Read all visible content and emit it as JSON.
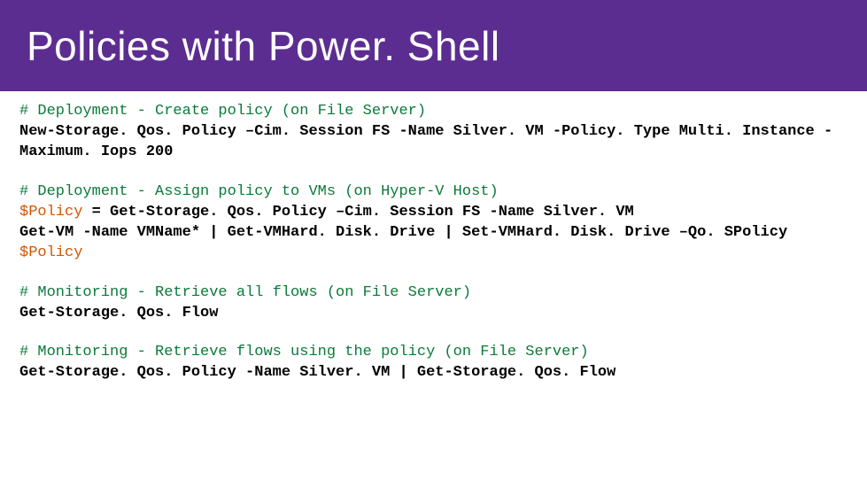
{
  "title": "Policies with Power. Shell",
  "blocks": [
    {
      "comment": "# Deployment - Create policy (on File Server)",
      "code_lines": [
        {
          "segments": [
            {
              "type": "cmd",
              "text": "New-Storage. Qos. Policy –Cim. Session FS -Name Silver. VM -Policy. Type Multi. Instance -Maximum. Iops 200"
            }
          ]
        }
      ]
    },
    {
      "comment": "# Deployment - Assign policy to VMs (on Hyper-V Host)",
      "code_lines": [
        {
          "segments": [
            {
              "type": "variable",
              "text": "$Policy "
            },
            {
              "type": "cmd",
              "text": "= Get-Storage. Qos. Policy –Cim. Session FS -Name Silver. VM"
            }
          ]
        },
        {
          "segments": [
            {
              "type": "cmd",
              "text": "Get-VM -Name VMName* | Get-VMHard. Disk. Drive | Set-VMHard. Disk. Drive –Qo. SPolicy "
            },
            {
              "type": "variable",
              "text": "$Policy"
            }
          ]
        }
      ]
    },
    {
      "comment": "# Monitoring - Retrieve all flows (on File Server)",
      "code_lines": [
        {
          "segments": [
            {
              "type": "cmd",
              "text": "Get-Storage. Qos. Flow"
            }
          ]
        }
      ]
    },
    {
      "comment": "# Monitoring - Retrieve flows using the policy (on File Server)",
      "code_lines": [
        {
          "segments": [
            {
              "type": "cmd",
              "text": "Get-Storage. Qos. Policy -Name Silver. VM | Get-Storage. Qos. Flow"
            }
          ]
        }
      ]
    }
  ]
}
